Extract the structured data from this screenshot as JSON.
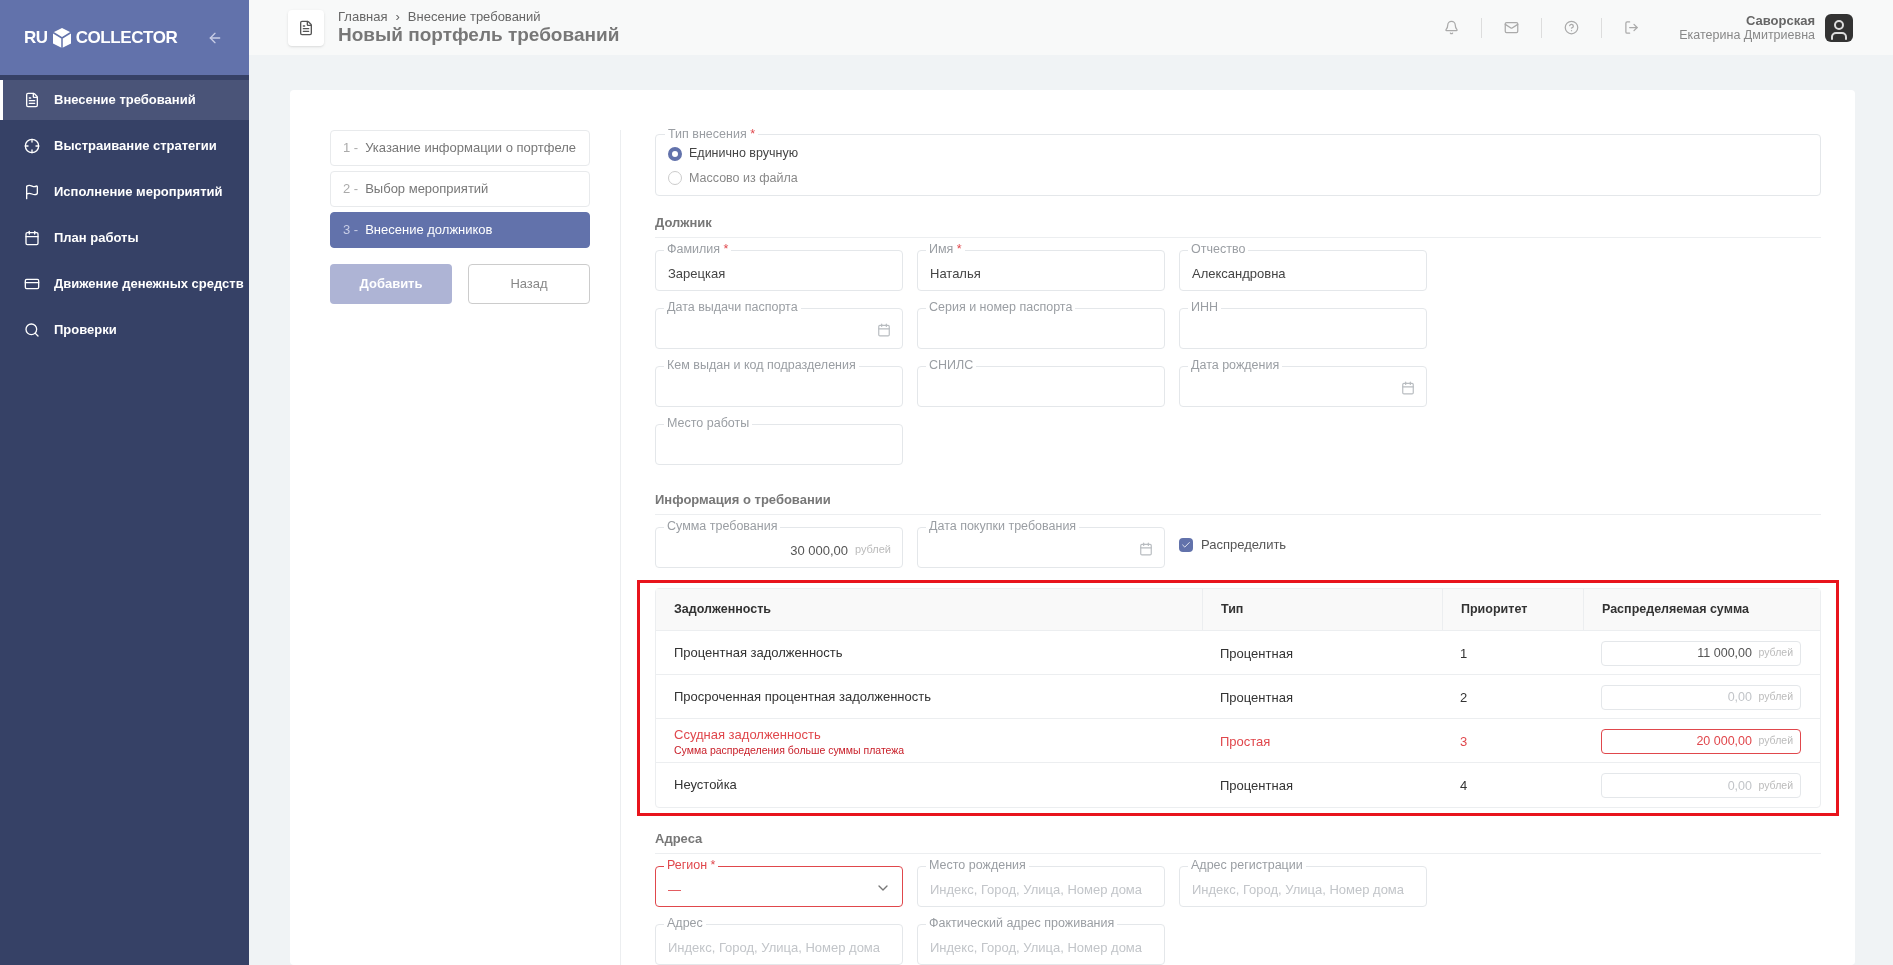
{
  "sidebar": {
    "logo": {
      "left": "RU",
      "right": "COLLECTOR"
    },
    "items": [
      {
        "label": "Внесение требований",
        "selected": true
      },
      {
        "label": "Выстраивание стратегии",
        "selected": false
      },
      {
        "label": "Исполнение мероприятий",
        "selected": false
      },
      {
        "label": "План работы",
        "selected": false
      },
      {
        "label": "Движение денежных средств",
        "selected": false
      },
      {
        "label": "Проверки",
        "selected": false
      }
    ]
  },
  "header": {
    "breadcrumbs": [
      "Главная",
      "Внесение требований"
    ],
    "separator": "›",
    "title": "Новый портфель требований",
    "user": {
      "last_name": "Саворская",
      "first_names": "Екатерина Дмитриевна"
    }
  },
  "steps": [
    {
      "number": "1 -",
      "label": "Указание информации о портфеле",
      "selected": false
    },
    {
      "number": "2 -",
      "label": "Выбор мероприятий",
      "selected": false
    },
    {
      "number": "3 -",
      "label": "Внесение должников",
      "selected": true
    }
  ],
  "buttons": [
    {
      "label": "Добавить",
      "kind": "primary",
      "disabled": true
    },
    {
      "label": "Назад",
      "kind": "secondary",
      "disabled": false
    }
  ],
  "entry_type": {
    "legend": "Тип внесения",
    "required_mark": "*",
    "options": [
      {
        "label": "Единично вручную",
        "selected": true
      },
      {
        "label": "Массово из файла",
        "selected": false
      }
    ]
  },
  "debtor": {
    "heading": "Должник",
    "fields": [
      {
        "label": "Фамилия",
        "required_mark": "*",
        "value": "Зарецкая",
        "kind": "text"
      },
      {
        "label": "Имя",
        "required_mark": "*",
        "value": "Наталья",
        "kind": "text"
      },
      {
        "label": "Отчество",
        "value": "Александровна",
        "kind": "text"
      },
      {
        "label": "Дата выдачи паспорта",
        "kind": "date"
      },
      {
        "label": "Серия и номер паспорта",
        "kind": "text"
      },
      {
        "label": "ИНН",
        "kind": "text"
      },
      {
        "label": "Кем выдан и код подразделения",
        "kind": "text"
      },
      {
        "label": "СНИЛС",
        "kind": "text"
      },
      {
        "label": "Дата рождения",
        "kind": "date"
      },
      {
        "label": "Место работы",
        "kind": "text"
      }
    ]
  },
  "claim": {
    "heading": "Информация о требовании",
    "amount": {
      "label": "Сумма требования",
      "value": "30 000,00",
      "unit": "рублей"
    },
    "purchase_date": {
      "label": "Дата покупки требования"
    },
    "distribute": {
      "label": "Распределить",
      "checked": true
    }
  },
  "table": {
    "columns": [
      "Задолженность",
      "Тип",
      "Приоритет",
      "Распределяемая сумма"
    ],
    "rows": [
      {
        "debt": "Процентная задолженность",
        "type": "Процентная",
        "priority": "1",
        "amount": {
          "value": "11 000,00",
          "unit": "рублей"
        },
        "invalid": false
      },
      {
        "debt": "Просроченная процентная задолженность",
        "type": "Процентная",
        "priority": "2",
        "amount": {
          "placeholder": "0,00",
          "unit": "рублей"
        },
        "invalid": false
      },
      {
        "debt": "Ссудная задолженность",
        "error": "Сумма распределения больше суммы платежа",
        "type": "Простая",
        "priority": "3",
        "amount": {
          "value": "20 000,00",
          "unit": "рублей"
        },
        "invalid": true
      },
      {
        "debt": "Неустойка",
        "type": "Процентная",
        "priority": "4",
        "amount": {
          "placeholder": "0,00",
          "unit": "рублей"
        },
        "invalid": false
      }
    ]
  },
  "addresses": {
    "heading": "Адреса",
    "fields": [
      {
        "label": "Регион",
        "required_mark": "*",
        "value": "—",
        "kind": "select",
        "invalid": true
      },
      {
        "label": "Место рождения",
        "placeholder": "Индекс, Город, Улица, Номер дома",
        "kind": "text",
        "invalid": false
      },
      {
        "label": "Адрес регистрации",
        "placeholder": "Индекс, Город, Улица, Номер дома",
        "kind": "text",
        "invalid": false
      },
      {
        "label": "Адрес",
        "placeholder": "Индекс, Город, Улица, Номер дома",
        "kind": "text",
        "invalid": false
      },
      {
        "label": "Фактический адрес проживания",
        "placeholder": "Индекс, Город, Улица, Номер дома",
        "kind": "text",
        "invalid": false
      }
    ]
  }
}
